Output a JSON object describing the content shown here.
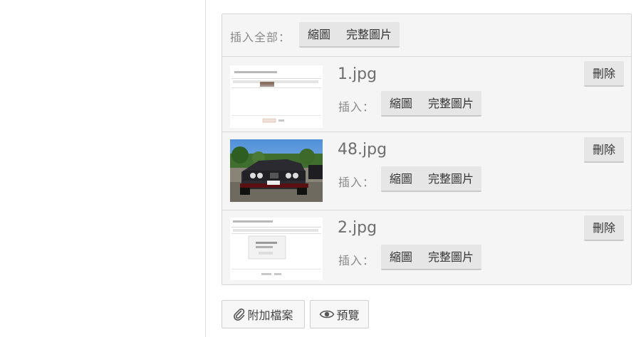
{
  "insert_all": {
    "label": "插入全部：",
    "thumb_button": "縮圖",
    "full_button": "完整圖片"
  },
  "attachments": [
    {
      "filename": "1.jpg",
      "insert_label": "插入：",
      "thumb_button": "縮圖",
      "full_button": "完整圖片",
      "delete_button": "刪除",
      "preview": "screenshot"
    },
    {
      "filename": "48.jpg",
      "insert_label": "插入：",
      "thumb_button": "縮圖",
      "full_button": "完整圖片",
      "delete_button": "刪除",
      "preview": "car-photo"
    },
    {
      "filename": "2.jpg",
      "insert_label": "插入：",
      "thumb_button": "縮圖",
      "full_button": "完整圖片",
      "delete_button": "刪除",
      "preview": "screenshot"
    }
  ],
  "footer": {
    "attach_button": "附加檔案",
    "preview_button": "預覽",
    "attach_icon": "paperclip-icon",
    "preview_icon": "eye-icon"
  }
}
